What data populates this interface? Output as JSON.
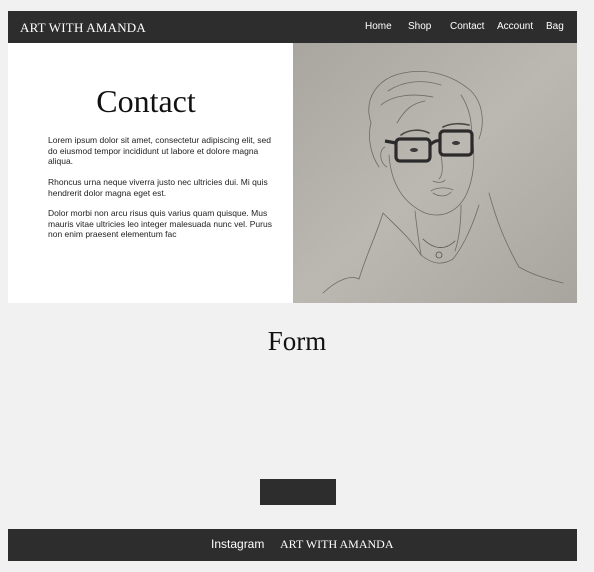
{
  "header": {
    "brand": "ART WITH AMANDA",
    "nav": [
      "Home",
      "Shop",
      "Contact",
      "Account",
      "Bag"
    ]
  },
  "hero": {
    "title": "Contact",
    "paragraphs": [
      "Lorem ipsum dolor sit amet, consectetur adipiscing elit, sed do eiusmod tempor incididunt ut labore et dolore magna aliqua.",
      " Rhoncus urna neque viverra justo nec ultricies dui. Mi quis hendrerit dolor magna eget est.",
      "Dolor morbi non arcu risus quis varius quam quisque. Mus mauris vitae ultricies leo integer malesuada nunc vel. Purus non enim praesent elementum fac"
    ]
  },
  "form": {
    "title": "Form",
    "submit_label": ""
  },
  "footer": {
    "link": "Instagram",
    "brand": "ART WITH AMANDA"
  }
}
